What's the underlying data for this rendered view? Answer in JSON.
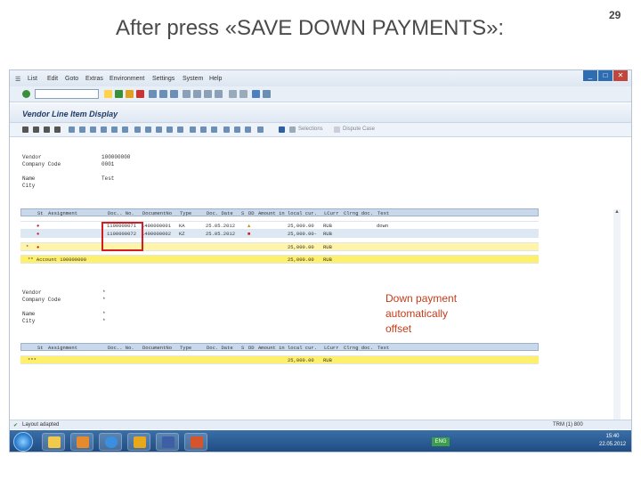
{
  "slide": {
    "title": "After press «SAVE DOWN PAYMENTS»:",
    "page_number": "29",
    "annotation": [
      "Down payment",
      "automatically",
      "offset"
    ]
  },
  "window": {
    "menu": [
      "List",
      "Edit",
      "Goto",
      "Extras",
      "Environment",
      "Settings",
      "System",
      "Help"
    ],
    "title": "Vendor Line Item Display",
    "toolbar_buttons": [
      "Selections",
      "Dispute Case"
    ]
  },
  "header1": {
    "labels": [
      "Vendor",
      "Company Code",
      "Name",
      "City"
    ],
    "values": [
      "100000000",
      "0001",
      "Test",
      ""
    ]
  },
  "table1": {
    "columns": [
      "St",
      "Assignment",
      "Doc.. No.",
      "DocumentNo",
      "Type",
      "Doc. Date",
      "S",
      "DD",
      "Amount in local cur.",
      "LCurr",
      "Clrng doc.",
      "Text"
    ],
    "rows": [
      {
        "flag": "",
        "docno": "1100000071",
        "docnum": "1400000001",
        "type": "KA",
        "date": "25.05.2012",
        "s": "",
        "amount": "25,000.00",
        "curr": "RUB",
        "text": "down"
      },
      {
        "flag": "",
        "docno": "1100000072",
        "docnum": "1400000002",
        "type": "KZ",
        "date": "25.05.2012",
        "s": "",
        "amount": "25,000.00-",
        "curr": "RUB",
        "text": ""
      }
    ],
    "subtotal": {
      "amount": "25,000.00",
      "curr": "RUB"
    },
    "total": {
      "label": "** Account 100000000",
      "amount": "25,000.00",
      "curr": "RUB"
    }
  },
  "header2": {
    "labels": [
      "Vendor",
      "Company Code",
      "Name",
      "City"
    ],
    "values": [
      "*",
      "*",
      "*",
      "*"
    ]
  },
  "table2": {
    "columns": [
      "St",
      "Assignment",
      "Doc.. No.",
      "DocumentNo",
      "Type",
      "Doc. Date",
      "S",
      "DD",
      "Amount in local cur.",
      "LCurr",
      "Clrng doc.",
      "Text"
    ],
    "total_label": "***",
    "total_amount": "25,000.00",
    "total_curr": "RUB"
  },
  "status": {
    "left": "Layout adapted",
    "right": "TRM (1) 800"
  },
  "taskbar": {
    "lang": "ENG",
    "time": "15:40",
    "date": "22.05.2012"
  },
  "colors": {
    "accent": "#c43c1a",
    "highlight": "#d21e1e",
    "title_bar": "#1f3b66"
  }
}
